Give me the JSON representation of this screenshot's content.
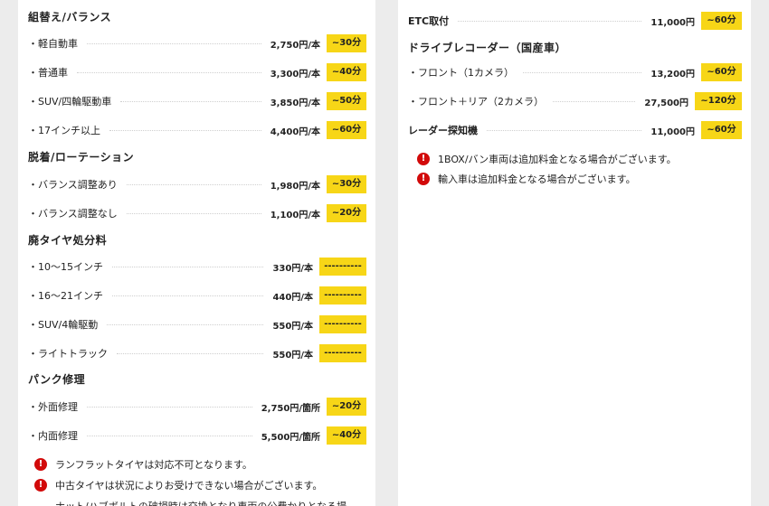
{
  "left": {
    "sections": [
      {
        "title": "組替え/バランス",
        "rows": [
          {
            "label": "・軽自動車",
            "price": "2,750円/本",
            "time": "~30分"
          },
          {
            "label": "・普通車",
            "price": "3,300円/本",
            "time": "~40分"
          },
          {
            "label": "・SUV/四輪駆動車",
            "price": "3,850円/本",
            "time": "~50分"
          },
          {
            "label": "・17インチ以上",
            "price": "4,400円/本",
            "time": "~60分"
          }
        ]
      },
      {
        "title": "脱着/ローテーション",
        "rows": [
          {
            "label": "・バランス調整あり",
            "price": "1,980円/本",
            "time": "~30分"
          },
          {
            "label": "・バランス調整なし",
            "price": "1,100円/本",
            "time": "~20分"
          }
        ]
      },
      {
        "title": "廃タイヤ処分料",
        "rows": [
          {
            "label": "・10～15インチ",
            "price": "330円/本",
            "time": "----------"
          },
          {
            "label": "・16～21インチ",
            "price": "440円/本",
            "time": "----------"
          },
          {
            "label": "・SUV/4輪駆動",
            "price": "550円/本",
            "time": "----------"
          },
          {
            "label": "・ライトトラック",
            "price": "550円/本",
            "time": "----------"
          }
        ]
      },
      {
        "title": "パンク修理",
        "rows": [
          {
            "label": "・外面修理",
            "price": "2,750円/箇所",
            "time": "~20分"
          },
          {
            "label": "・内面修理",
            "price": "5,500円/箇所",
            "time": "~40分"
          }
        ]
      }
    ],
    "notes": [
      "ランフラットタイヤは対応不可となります。",
      "中古タイヤは状況によりお受けできない場合がございます。",
      "ナット/ハブボルトの破損時は交換となり車両の公費かりとなる場"
    ]
  },
  "right": {
    "etc": {
      "label": "ETC取付",
      "price": "11,000円",
      "time": "~60分"
    },
    "dashcam": {
      "title": "ドライブレコーダー（国産車）",
      "rows": [
        {
          "label": "・フロント（1カメラ）",
          "price": "13,200円",
          "time": "~60分"
        },
        {
          "label": "・フロント＋リア（2カメラ）",
          "price": "27,500円",
          "time": "~120分"
        }
      ]
    },
    "radar": {
      "label": "レーダー探知機",
      "price": "11,000円",
      "time": "~60分"
    },
    "notes": [
      "1BOX/バン車両は追加料金となる場合がございます。",
      "輸入車は追加料金となる場合がございます。"
    ]
  },
  "icons": {
    "note": "exclamation-circle-icon"
  },
  "colors": {
    "badge": "#f7d617",
    "alert": "#d20a0a"
  }
}
